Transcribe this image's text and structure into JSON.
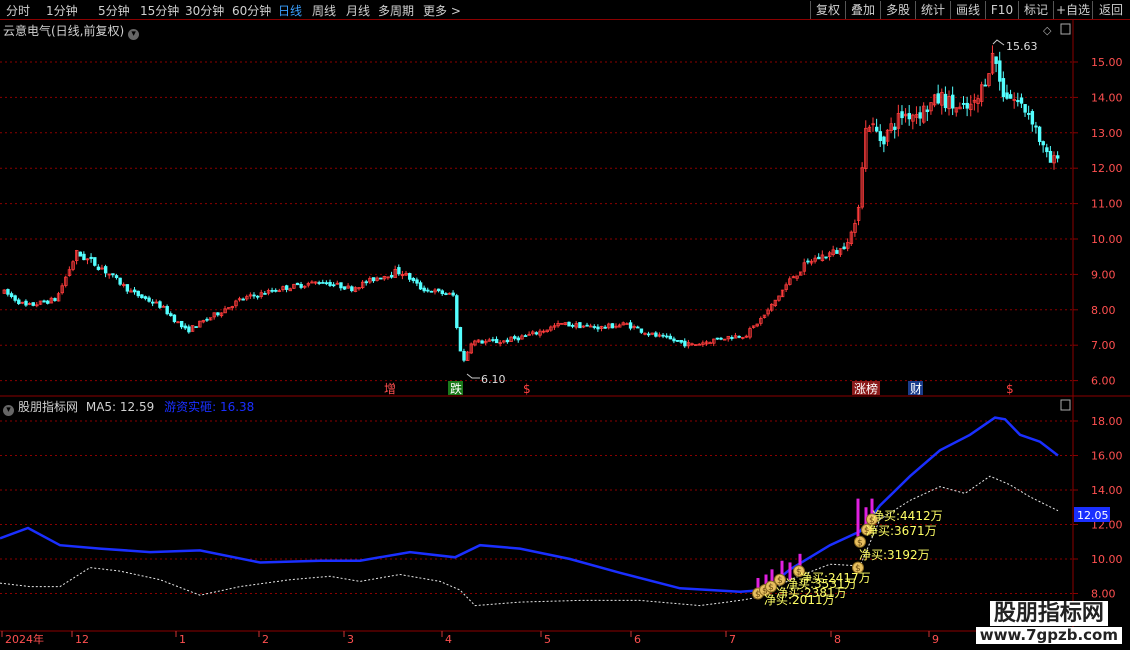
{
  "toolbar": {
    "periods": [
      "分时",
      "1分钟",
      "5分钟",
      "15分钟",
      "30分钟",
      "60分钟",
      "日线",
      "周线",
      "月线",
      "多周期",
      "更多 >"
    ],
    "active_period": "日线",
    "actions": [
      "复权",
      "叠加",
      "多股",
      "统计",
      "画线",
      "F10",
      "标记",
      "+自选",
      "返回"
    ]
  },
  "main_chart": {
    "title": "云意电气(日线,前复权)",
    "y_ticks": [
      "15.00",
      "14.00",
      "13.00",
      "12.00",
      "11.00",
      "10.00",
      "9.00",
      "8.00",
      "7.00",
      "6.00"
    ],
    "high_label": "15.63",
    "low_label": "6.10",
    "markers": [
      "增",
      "跌",
      "$",
      "涨榜",
      "财",
      "$"
    ]
  },
  "indicator": {
    "name": "股朋指标网",
    "ma5": "MA5: 12.59",
    "series_name": "游资实砸: 16.38",
    "y_ticks": [
      "18.00",
      "16.00",
      "14.00",
      "12.00",
      "10.00",
      "8.00"
    ],
    "current_value": "12.05",
    "net_buy_labels": [
      "净买:4412万",
      "净买:3671万",
      "净买:3192万",
      "净买:2417万",
      "净买:3531万",
      "净买:2381万",
      "净买:2011万"
    ]
  },
  "x_axis": {
    "labels": [
      "2024年",
      "12",
      "1",
      "2",
      "3",
      "4",
      "5",
      "6",
      "7",
      "8",
      "9"
    ]
  },
  "watermark": {
    "line1": "股朋指标网",
    "line2": "www.7gpzb.com"
  },
  "colors": {
    "up": "#ff3c3c",
    "down": "#54ffff",
    "line_blue": "#1a2fff",
    "grid": "#8b0000",
    "label": "#ffff66"
  },
  "chart_data": {
    "type": "candlestick",
    "title": "云意电气(日线,前复权)",
    "ylim": [
      5.8,
      16.0
    ],
    "key_points": [
      {
        "x": "2023-11",
        "close": 8.5
      },
      {
        "x": "2023-12",
        "close": 9.6
      },
      {
        "x": "2024-01",
        "close": 7.5
      },
      {
        "x": "2024-02",
        "close": 8.5
      },
      {
        "x": "2024-03",
        "close": 8.8
      },
      {
        "x": "2024-04",
        "close": 8.5
      },
      {
        "x": "2024-04",
        "low": 6.1
      },
      {
        "x": "2024-05",
        "close": 7.5
      },
      {
        "x": "2024-06",
        "close": 7.3
      },
      {
        "x": "2024-07",
        "close": 7.6
      },
      {
        "x": "2024-08",
        "close": 9.5
      },
      {
        "x": "2024-08",
        "close": 13.5
      },
      {
        "x": "2024-09",
        "close": 14.0
      },
      {
        "x": "2024-10",
        "high": 15.63
      },
      {
        "x": "2024-10",
        "close": 12.6
      }
    ]
  }
}
